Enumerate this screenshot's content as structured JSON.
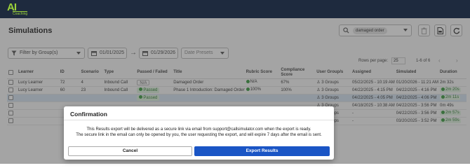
{
  "header": {
    "logo_text": "AI",
    "logo_subtext": "Coaching"
  },
  "page": {
    "title": "Simulations",
    "search_chip": "damaged order",
    "filter_group_placeholder": "Filter by Group(s)",
    "date_from": "01/01/2025",
    "date_to": "01/29/2026",
    "date_presets_placeholder": "Date Presets",
    "rows_per_page_label": "Rows per page:",
    "rows_per_page_value": "25",
    "page_range": "1-6 of 6"
  },
  "table": {
    "headers": [
      "",
      "Learner",
      "ID",
      "Scenario",
      "Type",
      "Passed / Failed",
      "Title",
      "Rubric Score",
      "Compliance Score",
      "User Group/s",
      "Assigned",
      "Simulated",
      "Duration"
    ],
    "rows": [
      {
        "learner": "Lucy Learner",
        "id": "72",
        "scenario": "4",
        "type": "Inbound Call",
        "status": "N/A",
        "status_kind": "na",
        "title": "Damaged Order",
        "rubric": "N/A",
        "compliance": "67%",
        "groups": "3 Groups",
        "assigned": "05/22/2025 - 10:19 AM",
        "simulated": "01/20/2026 - 11:21 AM",
        "duration": "2m 32s",
        "duration_kind": "plain",
        "selected": false
      },
      {
        "learner": "Lucy Learner",
        "id": "60",
        "scenario": "23",
        "type": "Inbound Call",
        "status": "Passed",
        "status_kind": "pass",
        "title": "Phase 1 Introduction: Damaged Order",
        "rubric": "100%",
        "compliance": "100%",
        "groups": "3 Groups",
        "assigned": "04/22/2025 - 4:15 PM",
        "simulated": "04/22/2025 - 4:16 PM",
        "duration": "2m 20s",
        "duration_kind": "pass",
        "selected": false
      },
      {
        "learner": "",
        "id": "",
        "scenario": "",
        "type": "",
        "status": "Passed",
        "status_kind": "pass",
        "title": "",
        "rubric": "",
        "compliance": "",
        "groups": "3 Groups",
        "assigned": "04/22/2025 - 4:05 PM",
        "simulated": "04/22/2025 - 4:06 PM",
        "duration": "2m 11s",
        "duration_kind": "pass",
        "selected": true
      },
      {
        "learner": "",
        "id": "",
        "scenario": "",
        "type": "",
        "status": "",
        "status_kind": "",
        "title": "",
        "rubric": "",
        "compliance": "",
        "groups": "3 Groups",
        "assigned": "04/18/2025 - 10:38 AM",
        "simulated": "04/22/2025 - 3:56 PM",
        "duration": "0m 49s",
        "duration_kind": "plain",
        "selected": false
      },
      {
        "learner": "",
        "id": "",
        "scenario": "",
        "type": "",
        "status": "",
        "status_kind": "",
        "title": "",
        "rubric": "",
        "compliance": "",
        "groups": "3 Groups",
        "assigned": "-",
        "simulated": "04/22/2025 - 3:56 PM",
        "duration": "2m 57s",
        "duration_kind": "pass",
        "selected": false
      },
      {
        "learner": "",
        "id": "",
        "scenario": "",
        "type": "",
        "status": "",
        "status_kind": "",
        "title": "",
        "rubric": "",
        "compliance": "",
        "groups": "3 Groups",
        "assigned": "-",
        "simulated": "03/20/2025 - 3:52 PM",
        "duration": "2m 59s",
        "duration_kind": "pass",
        "selected": false
      }
    ]
  },
  "dialog": {
    "title": "Confirmation",
    "message_line1": "This Results export will be delivered as a secure link via email from support@callsimulator.com when the export is ready.",
    "message_line2": "The secure link in the email can only be opened by you, the user requesting the export, and will expire 7 days after the email is sent.",
    "cancel_label": "Cancel",
    "export_label": "Export Results"
  },
  "colors": {
    "topbar": "#1e2a3e",
    "accent": "#1a55c5",
    "logo": "#9bd13a",
    "pass": "#2f7d32"
  },
  "icons": [
    "search-icon",
    "delete-icon",
    "pdf-export-icon",
    "refresh-icon",
    "filter-icon",
    "calendar-icon",
    "arrow-right-icon",
    "group-icon",
    "check-circle-icon"
  ]
}
